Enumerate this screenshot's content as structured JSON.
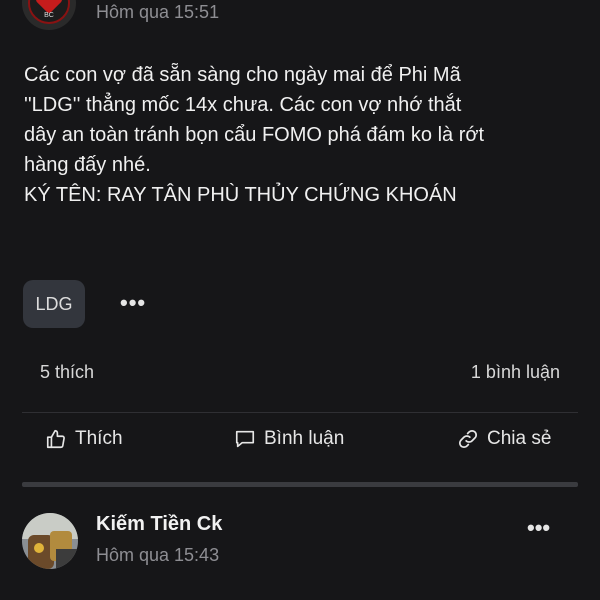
{
  "post1": {
    "avatar_text": "BC",
    "timestamp": "Hôm qua 15:51",
    "body_lines": [
      "Các con vợ đã sẵn sàng cho ngày mai để Phi Mã",
      "''LDG'' thẳng mốc 14x chưa. Các con vợ nhớ thắt",
      "dây an toàn tránh bọn cẩu FOMO phá đám ko là rớt",
      "hàng đấy nhé.",
      "KÝ TÊN: RAY TÂN PHÙ THỦY CHỨNG KHOÁN"
    ],
    "tag": "LDG",
    "more": "•••",
    "likes": "5 thích",
    "comments": "1 bình luận",
    "actions": {
      "like": "Thích",
      "comment": "Bình luận",
      "share": "Chia sẻ"
    }
  },
  "post2": {
    "author": "Kiếm Tiền Ck",
    "timestamp": "Hôm qua 15:43",
    "more": "•••"
  },
  "icons": {
    "like": "thumbs-up-icon",
    "comment": "speech-bubble-icon",
    "share": "share-link-icon",
    "more": "more-dots-icon"
  },
  "colors": {
    "background": "#161618",
    "chip": "#33363d",
    "muted_text": "#8e8e93"
  }
}
